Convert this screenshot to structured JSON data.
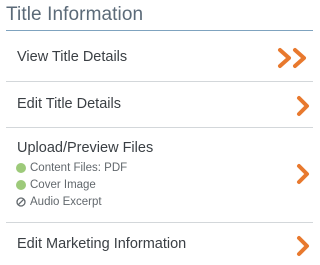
{
  "section": {
    "title": "Title Information"
  },
  "colors": {
    "accent": "#e8792e",
    "heading": "#5b6a78",
    "complete": "#9dca7a"
  },
  "items": [
    {
      "label": "View Title Details",
      "icon": "double-chevron-right-icon"
    },
    {
      "label": "Edit Title Details",
      "icon": "chevron-right-icon"
    },
    {
      "label": "Upload/Preview Files",
      "icon": "chevron-right-icon",
      "files": [
        {
          "label": "Content Files: PDF",
          "status": "complete",
          "icon": "green-dot-icon"
        },
        {
          "label": "Cover Image",
          "status": "complete",
          "icon": "green-dot-icon"
        },
        {
          "label": "Audio Excerpt",
          "status": "not-available",
          "icon": "no-entry-icon"
        }
      ]
    },
    {
      "label": "Edit Marketing Information",
      "icon": "chevron-right-icon"
    }
  ]
}
